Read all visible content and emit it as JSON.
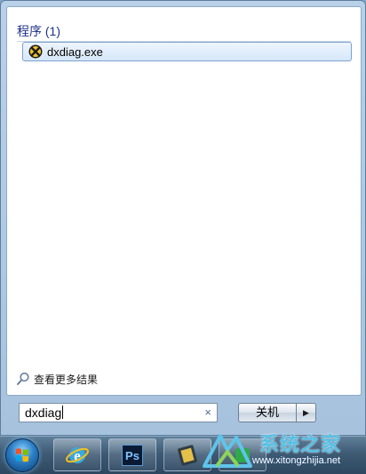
{
  "search_results": {
    "group_title": "程序 (1)",
    "items": [
      {
        "label": "dxdiag.exe",
        "icon": "dxdiag-icon"
      }
    ],
    "more_results_label": "查看更多结果"
  },
  "search": {
    "value": "dxdiag",
    "clear_glyph": "×"
  },
  "power": {
    "shutdown_label": "关机",
    "arrow_glyph": "▶"
  },
  "taskbar": {
    "pinned": [
      {
        "name": "start-button"
      },
      {
        "name": "internet-explorer-icon"
      },
      {
        "name": "photoshop-icon",
        "label": "Ps"
      },
      {
        "name": "media-app-icon"
      },
      {
        "name": "app-icon"
      }
    ]
  },
  "watermark": {
    "text": "系统之家",
    "url": "www.xitongzhijia.net"
  },
  "colors": {
    "header_text": "#1e3287",
    "selection_border": "#7da2ce",
    "taskbar": "#3e5a74"
  }
}
